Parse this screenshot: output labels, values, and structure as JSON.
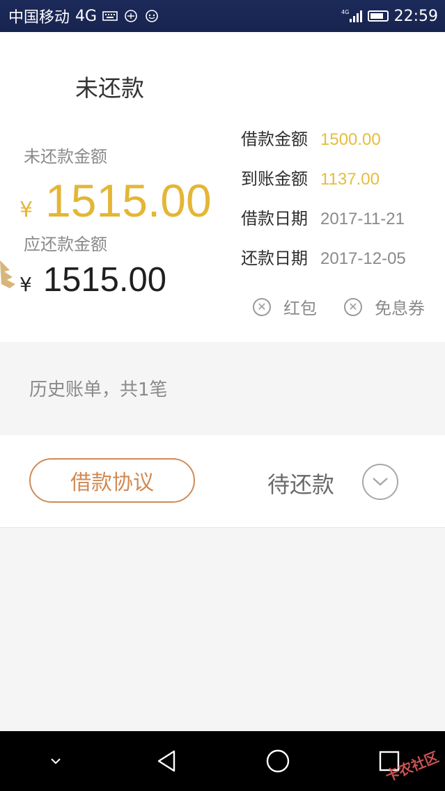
{
  "status_bar": {
    "carrier": "中国移动",
    "network": "4G",
    "time": "22:59",
    "signal_label": "4G"
  },
  "summary": {
    "title": "未还款",
    "unpaid_label": "未还款金额",
    "currency": "¥",
    "unpaid_amount": "1515.00",
    "due_label": "应还款金额",
    "due_amount": "1515.00"
  },
  "details": [
    {
      "key": "借款金额",
      "value": "1500.00",
      "color": "#e5bd3c"
    },
    {
      "key": "到账金额",
      "value": "1137.00",
      "color": "#e5bd3c"
    },
    {
      "key": "借款日期",
      "value": "2017-11-21",
      "color": "#8a8a8a"
    },
    {
      "key": "还款日期",
      "value": "2017-12-05",
      "color": "#8a8a8a"
    }
  ],
  "tags": {
    "red_packet": "红包",
    "interest_free": "免息券"
  },
  "history": {
    "text": "历史账单，共1笔"
  },
  "bill": {
    "agreement_label": "借款协议",
    "status_label": "待还款"
  },
  "watermark": "卡农社区",
  "colors": {
    "accent_yellow": "#e4b635",
    "agreement_orange": "#d08a55",
    "status_bar_bg": "#1c2a5a"
  }
}
